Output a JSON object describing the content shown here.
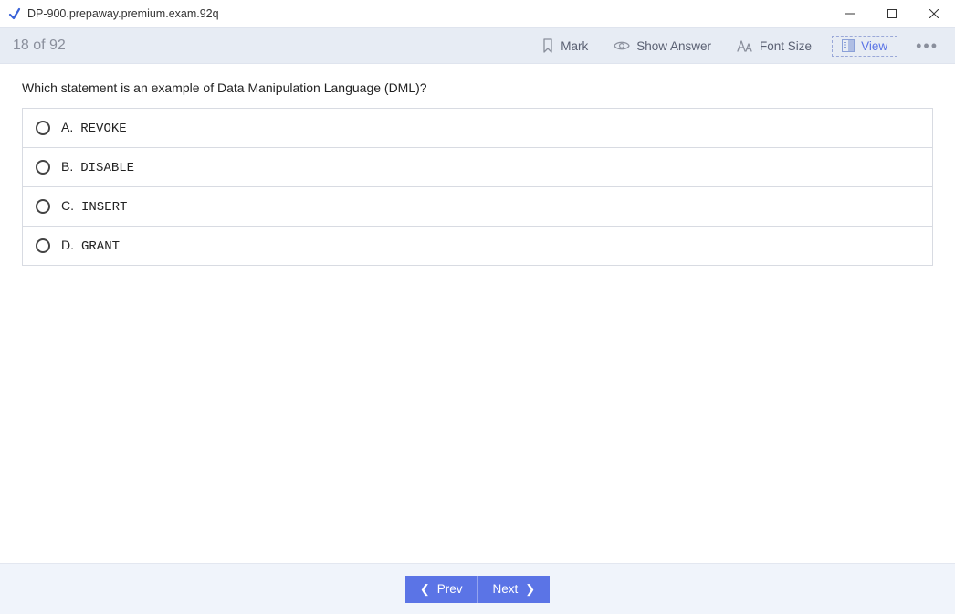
{
  "window": {
    "title": "DP-900.prepaway.premium.exam.92q"
  },
  "toolbar": {
    "progress": "18 of 92",
    "mark_label": "Mark",
    "show_answer_label": "Show Answer",
    "font_size_label": "Font Size",
    "view_label": "View"
  },
  "question": {
    "text": "Which statement is an example of Data Manipulation Language (DML)?",
    "options": [
      {
        "letter": "A.",
        "code": "REVOKE"
      },
      {
        "letter": "B.",
        "code": "DISABLE"
      },
      {
        "letter": "C.",
        "code": "INSERT"
      },
      {
        "letter": "D.",
        "code": "GRANT"
      }
    ]
  },
  "footer": {
    "prev_label": "Prev",
    "next_label": "Next"
  }
}
